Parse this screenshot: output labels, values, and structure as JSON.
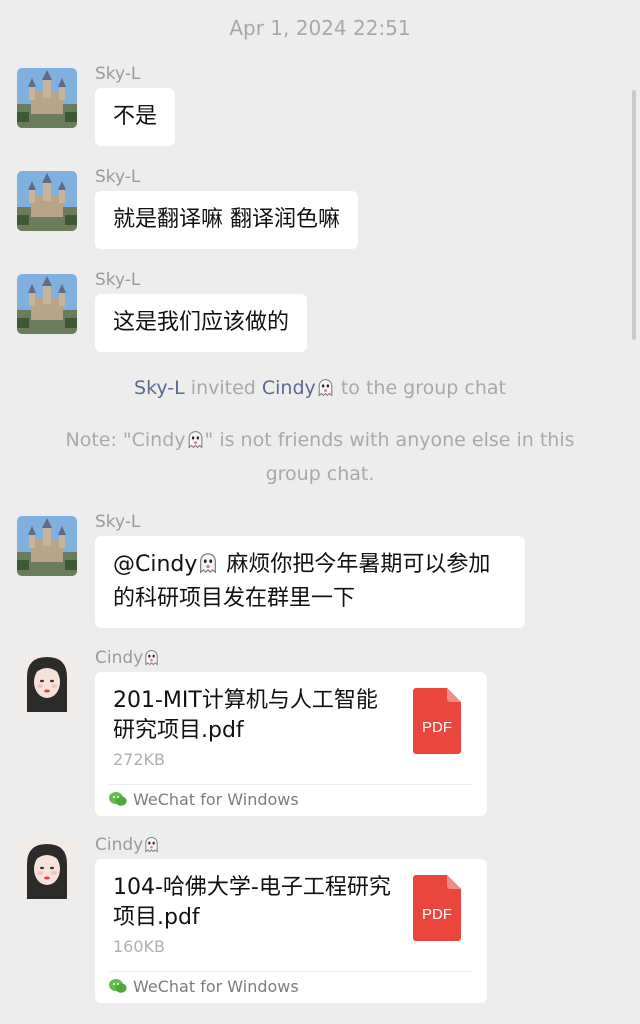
{
  "timestamp": "Apr 1, 2024 22:51",
  "messages": [
    {
      "sender": "Sky-L",
      "text": "不是"
    },
    {
      "sender": "Sky-L",
      "text": "就是翻译嘛 翻译润色嘛"
    },
    {
      "sender": "Sky-L",
      "text": "这是我们应该做的"
    }
  ],
  "system_invite": {
    "inviter": "Sky-L",
    "verb": " invited ",
    "invitee": "Cindy",
    "suffix": " to the group chat"
  },
  "system_note": {
    "prefix": "Note: \"Cindy",
    "suffix": "\" is not friends with anyone else in this group chat."
  },
  "mention_message": {
    "sender": "Sky-L",
    "mention": "@Cindy",
    "text": " 麻烦你把今年暑期可以参加的科研项目发在群里一下"
  },
  "files": [
    {
      "sender": "Cindy",
      "name": "201-MIT计算机与人工智能研究项目.pdf",
      "size": "272KB",
      "icon_label": "PDF",
      "footer": "WeChat for Windows"
    },
    {
      "sender": "Cindy",
      "name": "104-哈佛大学-电子工程研究项目.pdf",
      "size": "160KB",
      "icon_label": "PDF",
      "footer": "WeChat for Windows"
    }
  ],
  "colors": {
    "background": "#ededed",
    "bubble": "#ffffff",
    "link": "#5b6a91",
    "pdf": "#e9463e",
    "wechat": "#5fbf4a"
  }
}
